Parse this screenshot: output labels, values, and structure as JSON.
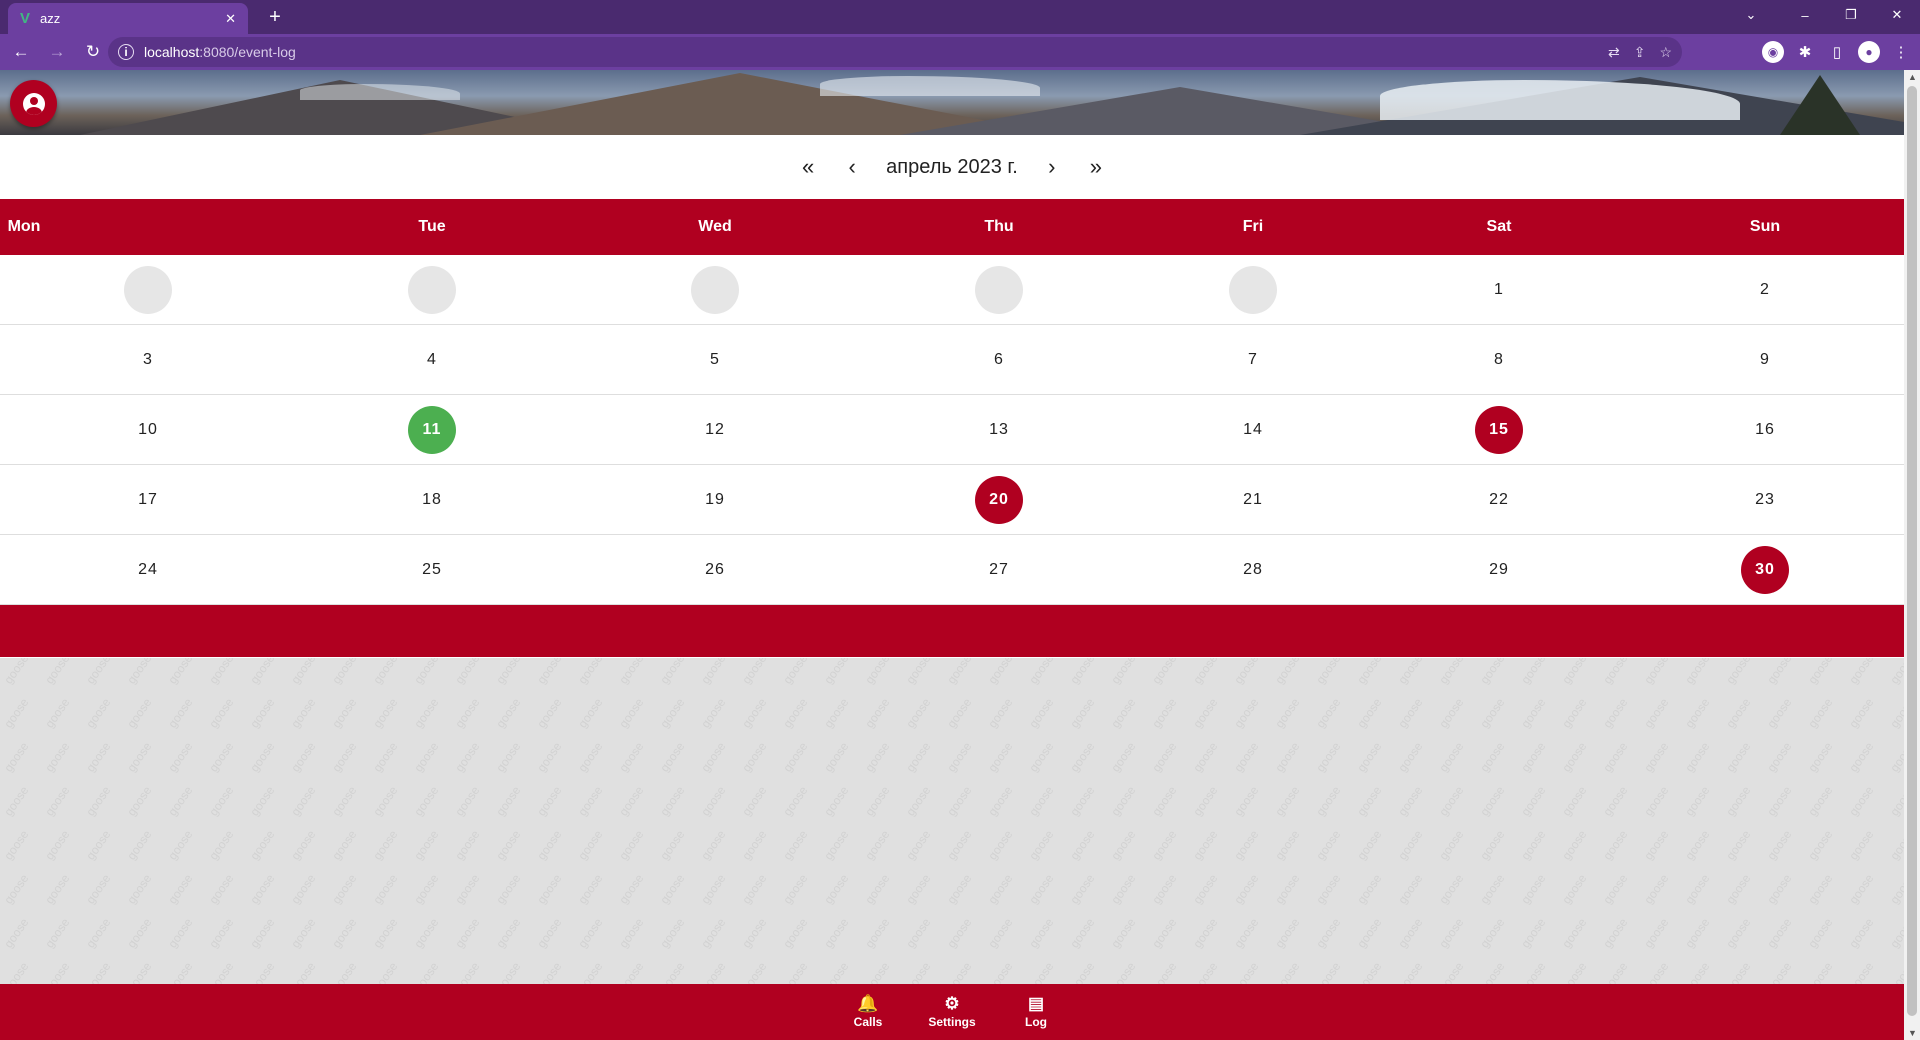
{
  "browser": {
    "tab_title": "azz",
    "tab_favicon": "V",
    "tab_close": "✕",
    "new_tab": "+",
    "url_host": "localhost",
    "url_path": ":8080/event-log",
    "window_controls": {
      "dropdown": "⌄",
      "minimize": "–",
      "restore": "❐",
      "close": "✕"
    }
  },
  "app": {
    "avatar_icon": "account-circle-icon",
    "month_nav": {
      "prev_year": "«",
      "prev_month": "‹",
      "title": "апрель 2023 г.",
      "next_month": "›",
      "next_year": "»"
    },
    "weekdays": [
      "Mon",
      "Tue",
      "Wed",
      "Thu",
      "Fri",
      "Sat",
      "Sun"
    ],
    "weeks": [
      [
        {
          "d": "",
          "s": "empty"
        },
        {
          "d": "",
          "s": "empty"
        },
        {
          "d": "",
          "s": "empty"
        },
        {
          "d": "",
          "s": "empty"
        },
        {
          "d": "",
          "s": "empty"
        },
        {
          "d": "1",
          "s": ""
        },
        {
          "d": "2",
          "s": ""
        }
      ],
      [
        {
          "d": "3",
          "s": ""
        },
        {
          "d": "4",
          "s": ""
        },
        {
          "d": "5",
          "s": ""
        },
        {
          "d": "6",
          "s": ""
        },
        {
          "d": "7",
          "s": ""
        },
        {
          "d": "8",
          "s": ""
        },
        {
          "d": "9",
          "s": ""
        }
      ],
      [
        {
          "d": "10",
          "s": ""
        },
        {
          "d": "11",
          "s": "green"
        },
        {
          "d": "12",
          "s": ""
        },
        {
          "d": "13",
          "s": ""
        },
        {
          "d": "14",
          "s": ""
        },
        {
          "d": "15",
          "s": "red"
        },
        {
          "d": "16",
          "s": ""
        }
      ],
      [
        {
          "d": "17",
          "s": ""
        },
        {
          "d": "18",
          "s": ""
        },
        {
          "d": "19",
          "s": ""
        },
        {
          "d": "20",
          "s": "red"
        },
        {
          "d": "21",
          "s": ""
        },
        {
          "d": "22",
          "s": ""
        },
        {
          "d": "23",
          "s": ""
        }
      ],
      [
        {
          "d": "24",
          "s": ""
        },
        {
          "d": "25",
          "s": ""
        },
        {
          "d": "26",
          "s": ""
        },
        {
          "d": "27",
          "s": ""
        },
        {
          "d": "28",
          "s": ""
        },
        {
          "d": "29",
          "s": ""
        },
        {
          "d": "30",
          "s": "red"
        }
      ]
    ],
    "watermark_text": "goose",
    "bottom_nav": [
      {
        "label": "Calls",
        "icon": "bell-icon",
        "glyph": "🔔"
      },
      {
        "label": "Settings",
        "icon": "gear-icon",
        "glyph": "⚙"
      },
      {
        "label": "Log",
        "icon": "log-icon",
        "glyph": "▤"
      }
    ],
    "colors": {
      "accent": "#b00020",
      "success": "#4caf50",
      "empty_day": "#e6e6e6"
    }
  }
}
